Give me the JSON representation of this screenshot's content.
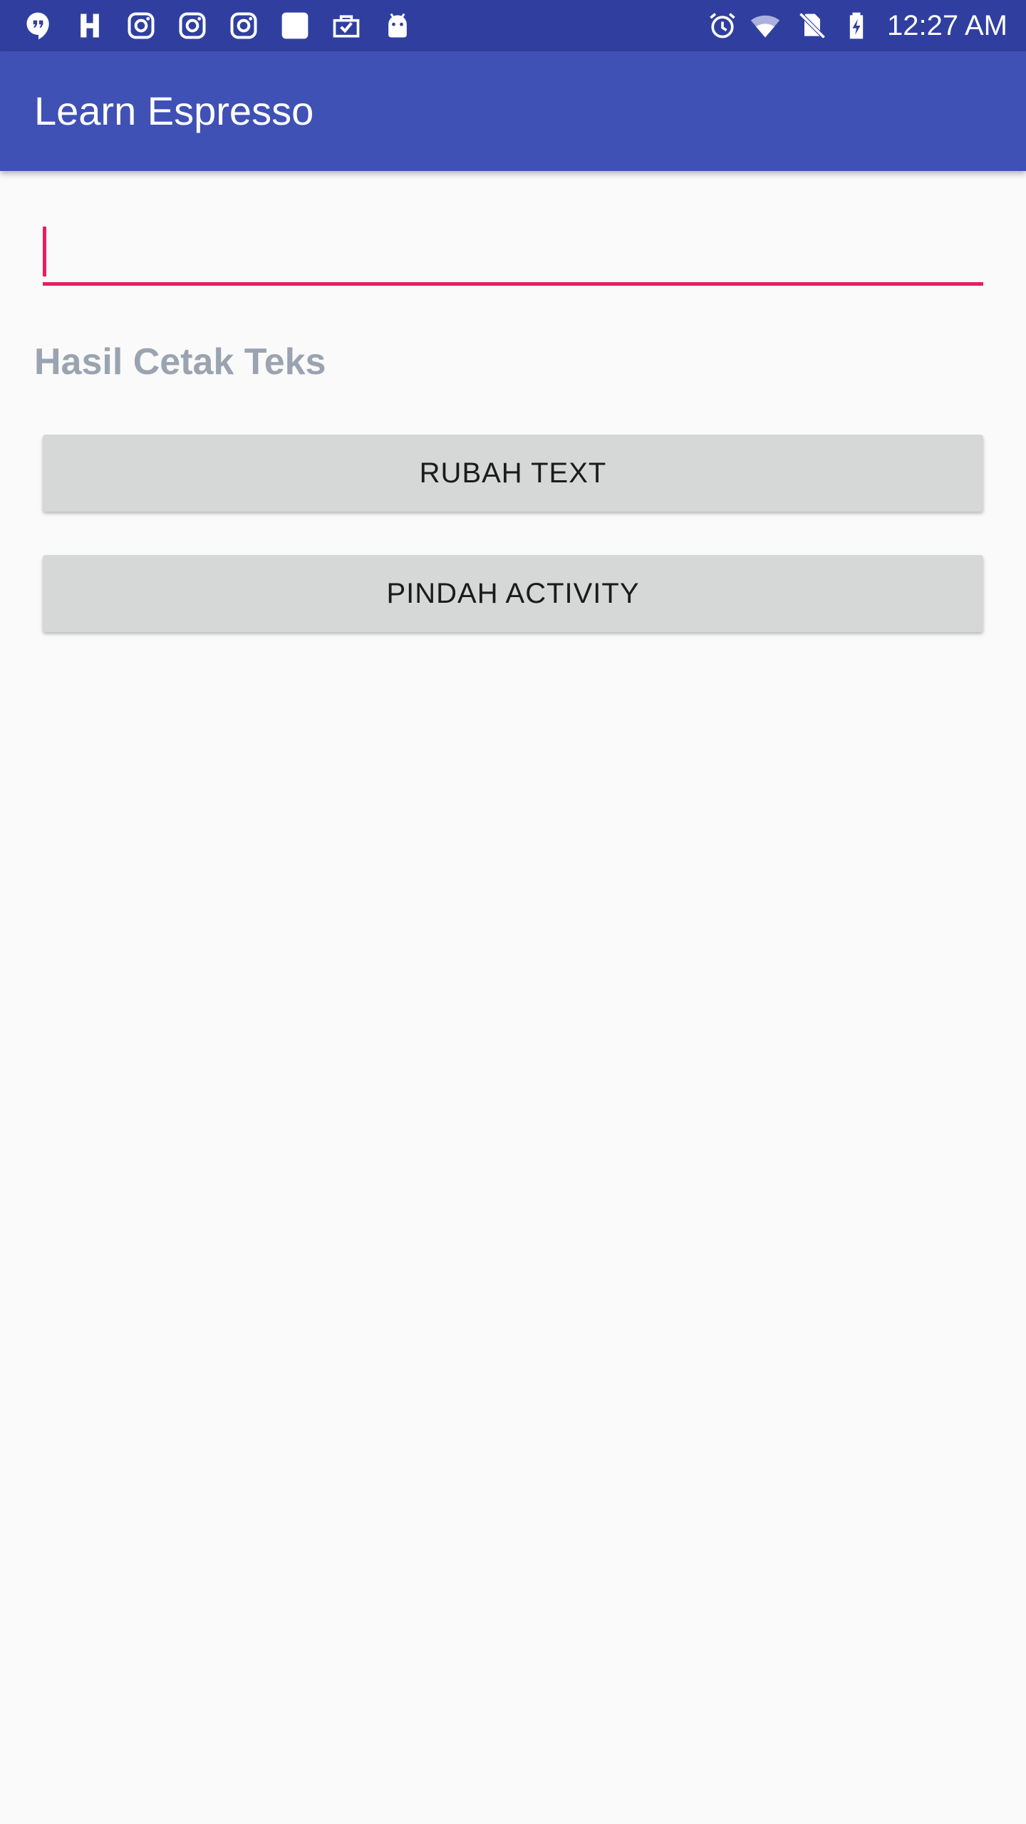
{
  "status_bar": {
    "time": "12:27 AM",
    "left_icons": [
      "hangouts-icon",
      "h-app-icon",
      "instagram-icon",
      "instagram-icon",
      "instagram-icon",
      "blank-square-icon",
      "briefcase-check-icon",
      "android-icon"
    ],
    "right_icons": [
      "alarm-icon",
      "wifi-icon",
      "no-sim-icon",
      "battery-charging-icon"
    ],
    "background": "#303f9f"
  },
  "app_bar": {
    "title": "Learn Espresso",
    "background": "#3f51b5"
  },
  "form": {
    "input_value": "",
    "input_placeholder": "",
    "accent_color": "#e91e63",
    "result_label": "Hasil Cetak Teks"
  },
  "buttons": {
    "change_text_label": "RUBAH TEXT",
    "move_activity_label": "PINDAH ACTIVITY"
  }
}
